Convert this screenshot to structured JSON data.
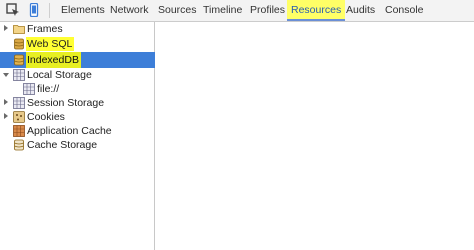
{
  "toolbar": {
    "tabs": [
      {
        "label": "Elements"
      },
      {
        "label": "Network"
      },
      {
        "label": "Sources"
      },
      {
        "label": "Timeline"
      },
      {
        "label": "Profiles"
      },
      {
        "label": "Resources",
        "active": true
      },
      {
        "label": "Audits"
      },
      {
        "label": "Console"
      }
    ]
  },
  "sidebar": {
    "items": [
      {
        "label": "Frames",
        "icon": "folder-icon",
        "expander": "collapsed"
      },
      {
        "label": "Web SQL",
        "icon": "database-icon",
        "highlighted": true
      },
      {
        "label": "IndexedDB",
        "icon": "database-icon",
        "selected": true,
        "highlighted": true
      },
      {
        "label": "Local Storage",
        "icon": "grid-storage-icon",
        "expander": "expanded"
      },
      {
        "label": "file://",
        "icon": "grid-storage-icon"
      },
      {
        "label": "Session Storage",
        "icon": "grid-storage-icon",
        "expander": "collapsed"
      },
      {
        "label": "Cookies",
        "icon": "cookie-icon",
        "expander": "collapsed"
      },
      {
        "label": "Application Cache",
        "icon": "application-cache-icon"
      },
      {
        "label": "Cache Storage",
        "icon": "database-icon"
      }
    ]
  },
  "colors": {
    "highlight": "#ffff33",
    "selection": "#3d7ed8",
    "active_tab_text": "#2a5db0"
  }
}
